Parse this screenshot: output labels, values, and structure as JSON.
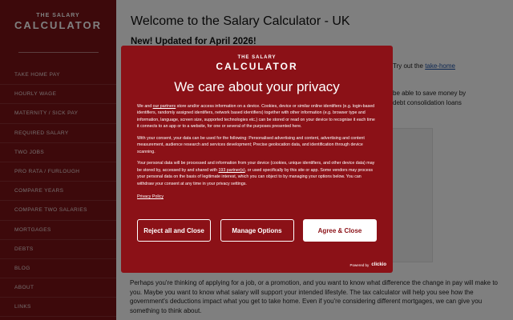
{
  "sidebar": {
    "logo_top": "THE SALARY",
    "logo_main": "CALCULATOR",
    "items": [
      "TAKE HOME PAY",
      "HOURLY WAGE",
      "MATERNITY / SICK PAY",
      "REQUIRED SALARY",
      "TWO JOBS",
      "PRO RATA / FURLOUGH",
      "COMPARE YEARS",
      "COMPARE TWO SALARIES",
      "MORTGAGES",
      "DEBTS",
      "BLOG",
      "ABOUT",
      "LINKS"
    ]
  },
  "main": {
    "title": "Welcome to the Salary Calculator - UK",
    "update": "New! Updated for April 2026!",
    "frag_try": "Try out the",
    "frag_link": "take-home",
    "frag_save": "be able to save money by",
    "frag_debt": "debt consolidation loans",
    "bottom_text": "Perhaps you're thinking of applying for a job, or a promotion, and you want to know what difference the change in pay will make to you. Maybe you want to know what salary will support your intended lifestyle. The tax calculator will help you see how the government's deductions impact what you get to take home. Even if you're considering different mortgages, we can give you something to think about."
  },
  "consent": {
    "logo_top": "THE SALARY",
    "logo_main": "CALCULATOR",
    "title": "We care about your privacy",
    "p1_a": "We and ",
    "p1_link": "our partners",
    "p1_b": " store and/or access information on a device. Cookies, device or similar online identifiers (e.g. login-based identifiers, randomly assigned identifiers, network based identifiers) together with other information (e.g. browser type and information, language, screen size, supported technologies etc.) can be stored or read on your device to recognise it each time it connects to an app or to a website, for one or several of the purposes presented here.",
    "p2": "With your consent, your data can be used for the following: Personalised advertising and content, advertising and content measurement, audience research and services development; Precise geolocation data, and identification through device scanning.",
    "p3_a": "Your personal data will be processed and information from your device (cookies, unique identifiers, and other device data) may be stored by, accessed by and shared with ",
    "p3_link": "193 partner(s)",
    "p3_b": ", or used specifically by this site or app. Some vendors may process your personal data on the basis of legitimate interest, which you can object to by managing your options below. You can withdraw your consent at any time in your privacy settings.",
    "policy": "Privacy Policy",
    "reject": "Reject all and Close",
    "manage": "Manage Options",
    "agree": "Agree & Close",
    "powered_by": "Powered by",
    "brand": "clickio"
  }
}
